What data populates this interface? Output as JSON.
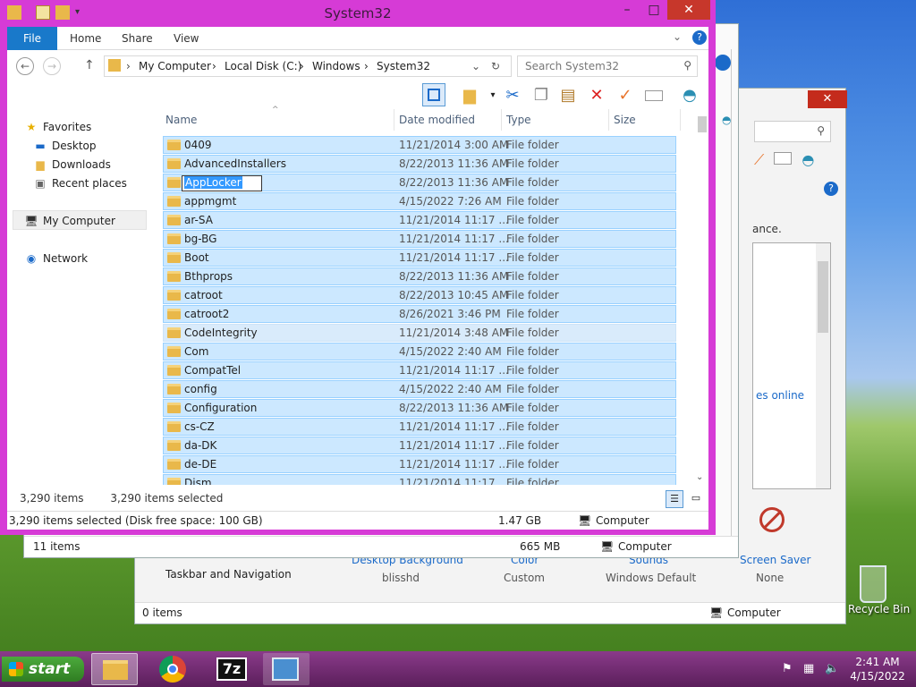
{
  "window": {
    "title": "System32",
    "minimize": "–",
    "maximize": "□",
    "close": "✕"
  },
  "ribbon": {
    "tabs": [
      "File",
      "Home",
      "Share",
      "View"
    ]
  },
  "address": {
    "crumbs": [
      "My Computer",
      "Local Disk (C:)",
      "Windows",
      "System32"
    ],
    "search_placeholder": "Search System32"
  },
  "columns": {
    "name": "Name",
    "date": "Date modified",
    "type": "Type",
    "size": "Size"
  },
  "nav": {
    "favorites": "Favorites",
    "desktop": "Desktop",
    "downloads": "Downloads",
    "recent": "Recent places",
    "computer": "My Computer",
    "network": "Network"
  },
  "rows": [
    {
      "name": "0409",
      "date": "11/21/2014 3:00 AM",
      "type": "File folder"
    },
    {
      "name": "AdvancedInstallers",
      "date": "8/22/2013 11:36 AM",
      "type": "File folder"
    },
    {
      "name": "AppLocker",
      "date": "8/22/2013 11:36 AM",
      "type": "File folder"
    },
    {
      "name": "appmgmt",
      "date": "4/15/2022 7:26 AM",
      "type": "File folder"
    },
    {
      "name": "ar-SA",
      "date": "11/21/2014 11:17 ...",
      "type": "File folder"
    },
    {
      "name": "bg-BG",
      "date": "11/21/2014 11:17 ...",
      "type": "File folder"
    },
    {
      "name": "Boot",
      "date": "11/21/2014 11:17 ...",
      "type": "File folder"
    },
    {
      "name": "Bthprops",
      "date": "8/22/2013 11:36 AM",
      "type": "File folder"
    },
    {
      "name": "catroot",
      "date": "8/22/2013 10:45 AM",
      "type": "File folder"
    },
    {
      "name": "catroot2",
      "date": "8/26/2021 3:46 PM",
      "type": "File folder"
    },
    {
      "name": "CodeIntegrity",
      "date": "11/21/2014 3:48 AM",
      "type": "File folder"
    },
    {
      "name": "Com",
      "date": "4/15/2022 2:40 AM",
      "type": "File folder"
    },
    {
      "name": "CompatTel",
      "date": "11/21/2014 11:17 ...",
      "type": "File folder"
    },
    {
      "name": "config",
      "date": "4/15/2022 2:40 AM",
      "type": "File folder"
    },
    {
      "name": "Configuration",
      "date": "8/22/2013 11:36 AM",
      "type": "File folder"
    },
    {
      "name": "cs-CZ",
      "date": "11/21/2014 11:17 ...",
      "type": "File folder"
    },
    {
      "name": "da-DK",
      "date": "11/21/2014 11:17 ...",
      "type": "File folder"
    },
    {
      "name": "de-DE",
      "date": "11/21/2014 11:17 ...",
      "type": "File folder"
    },
    {
      "name": "Dism",
      "date": "11/21/2014 11:17 ...",
      "type": "File folder"
    }
  ],
  "status": {
    "items": "3,290 items",
    "selected": "3,290 items selected",
    "bar_left": "3,290 items selected (Disk free space: 100 GB)",
    "bar_size": "1.47 GB",
    "bar_location": "Computer"
  },
  "back1": {
    "status_items": "11 items",
    "status_size": "665 MB",
    "status_location": "Computer"
  },
  "back2": {
    "text_ance": "ance.",
    "link_online": "es online",
    "taskbar_nav": "Taskbar and Navigation",
    "desktop_bg": "Desktop Background",
    "desktop_bg_val": "blisshd",
    "color": "Color",
    "color_val": "Custom",
    "sounds": "Sounds",
    "sounds_val": "Windows Default",
    "screensaver": "Screen Saver",
    "screensaver_val": "None",
    "status_items": "0 items",
    "status_location": "Computer"
  },
  "desktop": {
    "recycle_bin": "Recycle Bin"
  },
  "taskbar": {
    "start": "start",
    "time": "2:41 AM",
    "date": "4/15/2022",
    "app_7z": "7z"
  },
  "colors": {
    "accent": "#1979ca",
    "selection": "#cce8ff",
    "frame": "#d63bd6"
  }
}
